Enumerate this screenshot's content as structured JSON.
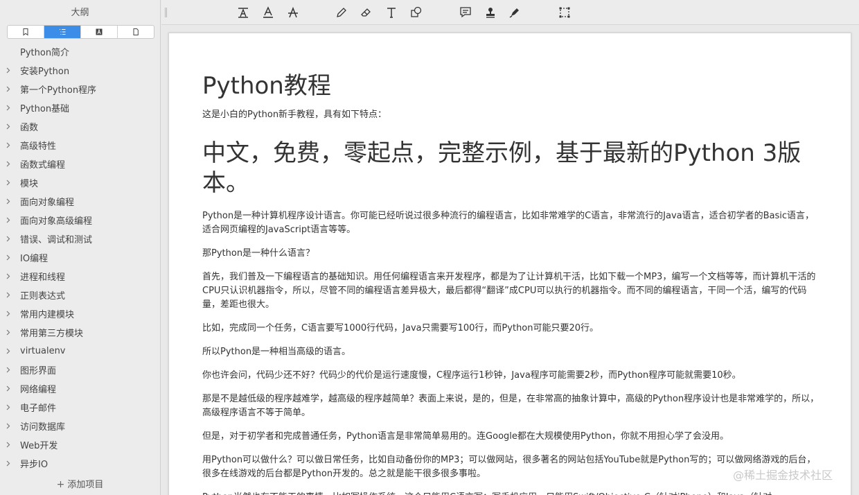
{
  "sidebar": {
    "title": "大纲",
    "tabs": [
      "bookmark-icon",
      "outline-list-icon",
      "annotation-icon",
      "page-icon"
    ],
    "items": [
      {
        "label": "Python简介",
        "expandable": false
      },
      {
        "label": "安装Python",
        "expandable": true
      },
      {
        "label": "第一个Python程序",
        "expandable": true
      },
      {
        "label": "Python基础",
        "expandable": true
      },
      {
        "label": "函数",
        "expandable": true
      },
      {
        "label": "高级特性",
        "expandable": true
      },
      {
        "label": "函数式编程",
        "expandable": true
      },
      {
        "label": "模块",
        "expandable": true
      },
      {
        "label": "面向对象编程",
        "expandable": true
      },
      {
        "label": "面向对象高级编程",
        "expandable": true
      },
      {
        "label": "错误、调试和测试",
        "expandable": true
      },
      {
        "label": "IO编程",
        "expandable": true
      },
      {
        "label": "进程和线程",
        "expandable": true
      },
      {
        "label": "正则表达式",
        "expandable": true
      },
      {
        "label": "常用内建模块",
        "expandable": true
      },
      {
        "label": "常用第三方模块",
        "expandable": true
      },
      {
        "label": "virtualenv",
        "expandable": true
      },
      {
        "label": "图形界面",
        "expandable": true
      },
      {
        "label": "网络编程",
        "expandable": true
      },
      {
        "label": "电子邮件",
        "expandable": true
      },
      {
        "label": "访问数据库",
        "expandable": true
      },
      {
        "label": "Web开发",
        "expandable": true
      },
      {
        "label": "异步IO",
        "expandable": true
      }
    ],
    "add_label": "添加项目"
  },
  "toolbar": {
    "icons": [
      "text-style-icon",
      "text-underline-icon",
      "text-strikethrough-icon",
      "pencil-icon",
      "eraser-icon",
      "text-box-icon",
      "shapes-icon",
      "note-icon",
      "stamp-icon",
      "signature-pen-icon",
      "selection-icon"
    ]
  },
  "document": {
    "title": "Python教程",
    "intro": "这是小白的Python新手教程，具有如下特点：",
    "headline": "中文，免费，零起点，完整示例，基于最新的Python 3版本。",
    "paragraphs": [
      "Python是一种计算机程序设计语言。你可能已经听说过很多种流行的编程语言，比如非常难学的C语言，非常流行的Java语言，适合初学者的Basic语言，适合网页编程的JavaScript语言等等。",
      "那Python是一种什么语言？",
      "首先，我们普及一下编程语言的基础知识。用任何编程语言来开发程序，都是为了让计算机干活，比如下载一个MP3，编写一个文档等等，而计算机干活的CPU只认识机器指令，所以，尽管不同的编程语言差异极大，最后都得“翻译”成CPU可以执行的机器指令。而不同的编程语言，干同一个活，编写的代码量，差距也很大。",
      "比如，完成同一个任务，C语言要写1000行代码，Java只需要写100行，而Python可能只要20行。",
      "所以Python是一种相当高级的语言。",
      "你也许会问，代码少还不好？代码少的代价是运行速度慢，C程序运行1秒钟，Java程序可能需要2秒，而Python程序可能就需要10秒。",
      "那是不是越低级的程序越难学，越高级的程序越简单？表面上来说，是的，但是，在非常高的抽象计算中，高级的Python程序设计也是非常难学的，所以，高级程序语言不等于简单。",
      "但是，对于初学者和完成普通任务，Python语言是非常简单易用的。连Google都在大规模使用Python，你就不用担心学了会没用。",
      "用Python可以做什么？可以做日常任务，比如自动备份你的MP3；可以做网站，很多著名的网站包括YouTube就是Python写的；可以做网络游戏的后台，很多在线游戏的后台都是Python开发的。总之就是能干很多很多事啦。",
      "Python当然也有不能干的事情，比如写操作系统，这个只能用C语言写；写手机应用，只能用Swift/Objective-C（针对iPhone）和Java（针对"
    ]
  },
  "watermark": "@稀土掘金技术社区",
  "colors": {
    "accent": "#3c8de8",
    "sidebar_bg": "#ececec",
    "page_bg": "#ffffff"
  }
}
